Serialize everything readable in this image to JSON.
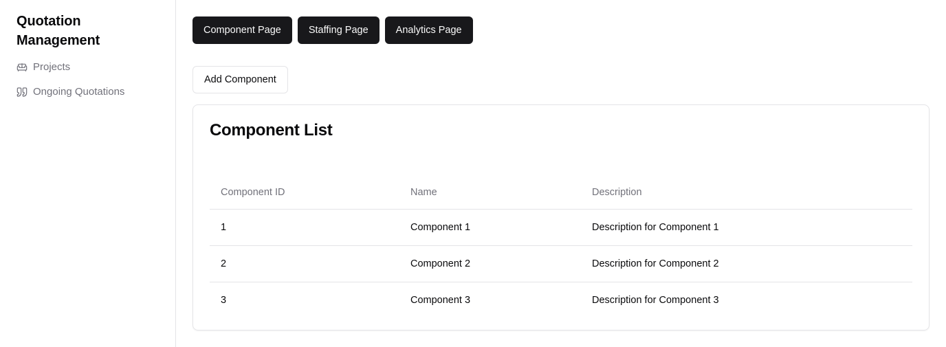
{
  "sidebar": {
    "title": "Quotation Management",
    "items": [
      {
        "label": "Projects",
        "icon": "sofa-icon"
      },
      {
        "label": "Ongoing Quotations",
        "icon": "quote-icon"
      }
    ]
  },
  "header": {
    "buttons": [
      {
        "label": "Component Page"
      },
      {
        "label": "Staffing Page"
      },
      {
        "label": "Analytics Page"
      }
    ]
  },
  "actions": {
    "add_label": "Add Component"
  },
  "card": {
    "title": "Component List",
    "columns": [
      "Component ID",
      "Name",
      "Description"
    ],
    "rows": [
      {
        "id": "1",
        "name": "Component 1",
        "description": "Description for Component 1"
      },
      {
        "id": "2",
        "name": "Component 2",
        "description": "Description for Component 2"
      },
      {
        "id": "3",
        "name": "Component 3",
        "description": "Description for Component 3"
      }
    ]
  },
  "colors": {
    "primary": "#18181b",
    "muted_text": "#71717a",
    "border": "#e4e4e7"
  }
}
